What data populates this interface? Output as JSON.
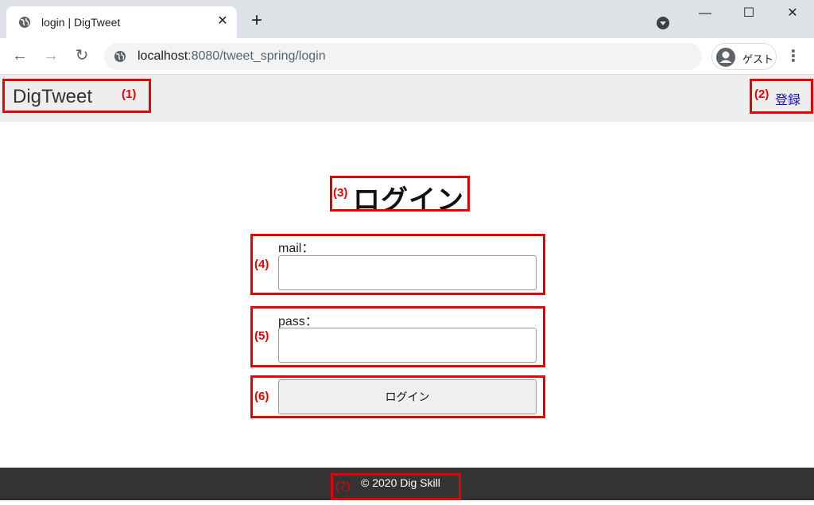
{
  "browser": {
    "tab_title": "login | DigTweet",
    "tab_close": "✕",
    "new_tab": "+",
    "url_host": "localhost",
    "url_rest": ":8080/tweet_spring/login",
    "profile_label": "ゲスト",
    "back": "←",
    "forward": "→",
    "reload": "↻",
    "menu": "⋮",
    "minimize": "—",
    "maximize": "☐",
    "close": "✕"
  },
  "header": {
    "brand": "DigTweet",
    "register_link": "登録"
  },
  "main": {
    "title": "ログイン",
    "mail_label": "mail：",
    "mail_value": "",
    "pass_label": "pass：",
    "pass_value": "",
    "login_button": "ログイン"
  },
  "footer": {
    "copyright": "© 2020 Dig Skill"
  },
  "annotations": {
    "a1": "(1)",
    "a2": "(2)",
    "a3": "(3)",
    "a4": "(4)",
    "a5": "(5)",
    "a6": "(6)",
    "a7": "(7)"
  },
  "colors": {
    "annotation_red": "#e60000",
    "header_bg": "#eeeeee",
    "footer_bg": "#333333",
    "link": "#1a0dab"
  }
}
